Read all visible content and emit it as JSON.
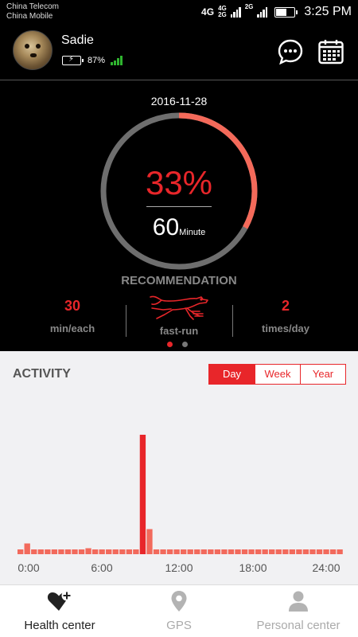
{
  "status_bar": {
    "carrier_1": "China Telecom",
    "carrier_2": "China Mobile",
    "net_a": "4G",
    "net_b_top": "4G",
    "net_b_bottom": "2G",
    "net_c": "2G",
    "time": "3:25 PM"
  },
  "profile": {
    "name": "Sadie",
    "battery_percent": "87%",
    "battery_level": 0.87
  },
  "summary": {
    "date": "2016-11-28",
    "progress_text": "33%",
    "progress_fraction": 0.33,
    "minutes_value": "60",
    "minutes_unit": "Minute",
    "recommendation_title": "RECOMMENDATION",
    "per_session_value": "30",
    "per_session_label": "min/each",
    "exercise_label": "fast-run",
    "frequency_value": "2",
    "frequency_label": "times/day",
    "page_index": 0,
    "page_count": 2
  },
  "activity": {
    "title": "ACTIVITY",
    "tabs": [
      "Day",
      "Week",
      "Year"
    ],
    "selected_tab": "Day",
    "x_ticks": [
      "0:00",
      "6:00",
      "12:00",
      "18:00",
      "24:00"
    ]
  },
  "chart_data": {
    "type": "bar",
    "title": "ACTIVITY",
    "xlabel": "",
    "ylabel": "",
    "categories": [
      "0:00",
      "0:30",
      "1:00",
      "1:30",
      "2:00",
      "2:30",
      "3:00",
      "3:30",
      "4:00",
      "4:30",
      "5:00",
      "5:30",
      "6:00",
      "6:30",
      "7:00",
      "7:30",
      "8:00",
      "8:30",
      "9:00",
      "9:30",
      "10:00",
      "10:30",
      "11:00",
      "11:30",
      "12:00",
      "12:30",
      "13:00",
      "13:30",
      "14:00",
      "14:30",
      "15:00",
      "15:30",
      "16:00",
      "16:30",
      "17:00",
      "17:30",
      "18:00",
      "18:30",
      "19:00",
      "19:30",
      "20:00",
      "20:30",
      "21:00",
      "21:30",
      "22:00",
      "22:30",
      "23:00",
      "23:30"
    ],
    "values": [
      4,
      9,
      4,
      4,
      4,
      4,
      4,
      4,
      4,
      4,
      5,
      4,
      4,
      4,
      4,
      4,
      4,
      4,
      100,
      21,
      4,
      4,
      4,
      4,
      4,
      4,
      4,
      4,
      4,
      4,
      4,
      4,
      4,
      4,
      4,
      4,
      4,
      4,
      4,
      4,
      4,
      4,
      4,
      4,
      4,
      4,
      4,
      4
    ],
    "ylim": [
      0,
      100
    ],
    "grid": false,
    "color": "#f26a5c",
    "highlight_color": "#e8262a"
  },
  "nav": {
    "items": [
      {
        "label": "Health center",
        "icon": "heart-plus-icon",
        "active": true
      },
      {
        "label": "GPS",
        "icon": "location-pin-icon",
        "active": false
      },
      {
        "label": "Personal center",
        "icon": "person-icon",
        "active": false
      }
    ]
  },
  "colors": {
    "accent": "#e8262a",
    "ring_track": "#6e6e6e",
    "ring_progress": "#f46a5a",
    "device_signal": "#2fb52f"
  }
}
